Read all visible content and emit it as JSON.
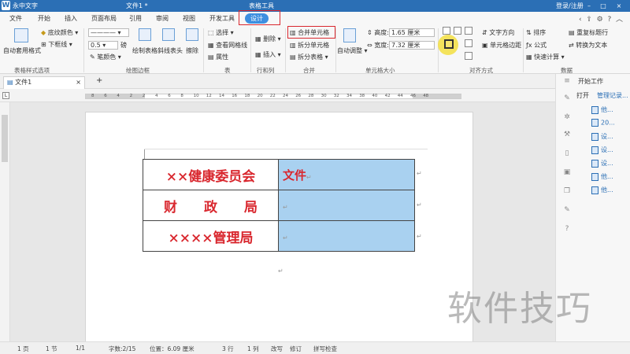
{
  "titlebar": {
    "app": "永中文字",
    "doc": "文件1 *",
    "context": "表格工具",
    "login": "登录/注册"
  },
  "tabs": [
    "文件",
    "开始",
    "插入",
    "页面布局",
    "引用",
    "审阅",
    "视图",
    "开发工具",
    "设计"
  ],
  "ribbon": {
    "auto_style": "自动套用格式",
    "shading": "底纹颜色",
    "underline": "下框线",
    "group_style": "表格样式选项",
    "line_width": "0.5",
    "line_unit": "磅",
    "pen_color": "笔颜色",
    "draw_table": "绘制表格",
    "diagonal": "斜线表头",
    "eraser": "擦除",
    "group_border": "绘图边框",
    "select": "选择",
    "gridlines": "查看网格线",
    "properties": "属性",
    "group_table": "表",
    "delete": "删除",
    "insert": "插入",
    "group_rowcol": "行和列",
    "merge": "合并单元格",
    "split_cells": "拆分单元格",
    "split_table": "拆分表格",
    "group_merge": "合并",
    "auto_adjust": "自动调整",
    "height_label": "高度:",
    "height_val": "1.65 厘米",
    "width_label": "宽度:",
    "width_val": "7.32 厘米",
    "group_cellsize": "单元格大小",
    "text_dir": "文字方向",
    "cell_margin": "单元格边距",
    "group_align": "对齐方式",
    "sort": "排序",
    "formula": "公式",
    "quick_calc": "快速计算",
    "repeat_header": "重复标题行",
    "to_text": "转换为文本",
    "group_data": "数据"
  },
  "doctab": {
    "name": "文件1",
    "close": "×",
    "add": "+"
  },
  "ruler": [
    "8",
    "6",
    "4",
    "2",
    "2",
    "4",
    "6",
    "8",
    "10",
    "12",
    "14",
    "16",
    "18",
    "20",
    "22",
    "24",
    "26",
    "28",
    "30",
    "32",
    "34",
    "38",
    "40",
    "42",
    "44",
    "46",
    "48"
  ],
  "table": {
    "rows": [
      {
        "left": "××健康委员会",
        "right": "文件"
      },
      {
        "left": "财　　政　　局",
        "right": ""
      },
      {
        "left": "××××管理局",
        "right": ""
      }
    ]
  },
  "sidebar": {
    "header": "开始工作",
    "open": "打开",
    "manage": "管理记录...",
    "files": [
      "他...",
      "20...",
      "设...",
      "设...",
      "设...",
      "他...",
      "他..."
    ]
  },
  "statusbar": {
    "page": "1 页",
    "section": "1 节",
    "pages": "1/1",
    "words": "字数:2/15",
    "position": "位置：6.09 厘米",
    "row": "3 行",
    "col": "1 列",
    "rewrite": "改写",
    "revise": "修订",
    "spell": "拼写检查"
  },
  "watermark": "软件技巧"
}
